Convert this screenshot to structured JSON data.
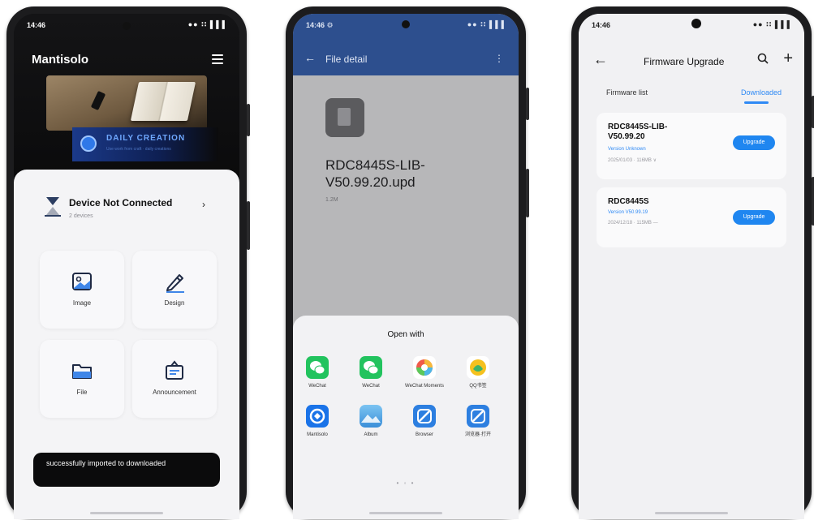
{
  "phone1": {
    "status": {
      "time": "14:46",
      "icons": "●● ∶∶ ▌▌▌"
    },
    "app_title": "Mantisolo",
    "brand": {
      "name": "DAILY CREATION",
      "tagline": "Use work from craft · daily creations"
    },
    "device": {
      "title": "Device Not Connected",
      "subtitle": "2 devices",
      "more": "›"
    },
    "tiles": [
      {
        "label": "Image",
        "icon": "image-icon"
      },
      {
        "label": "Design",
        "icon": "pen-icon"
      },
      {
        "label": "File",
        "icon": "folder-icon"
      },
      {
        "label": "Announcement",
        "icon": "announcement-icon"
      }
    ],
    "toast": "successfully imported to downloaded"
  },
  "phone2": {
    "status": {
      "time": "14:46 ⚙",
      "icons": "●● ∶∶ ▌▌▌"
    },
    "title": "File detail",
    "file_name": "RDC8445S-LIB-V50.99.20.upd",
    "file_size": "1.2M",
    "share_title": "Open with",
    "apps": [
      {
        "label": "WeChat",
        "color": "#22c35e"
      },
      {
        "label": "WeChat",
        "color": "#22c35e"
      },
      {
        "label": "WeChat Moments",
        "color": "#ffffff"
      },
      {
        "label": "QQ书签",
        "color": "#ffffff"
      },
      {
        "label": "Mantisolo",
        "color": "#1a73e8"
      },
      {
        "label": "Album",
        "color": "#4aa3e8"
      },
      {
        "label": "Browser",
        "color": "#2d7fe0"
      },
      {
        "label": "浏览器·打开",
        "color": "#2d7fe0"
      }
    ],
    "dots": "• ◦ •"
  },
  "phone3": {
    "status": {
      "time": "14:46",
      "icons": "●● ∶∶ ▌▌▌"
    },
    "title": "Firmware Upgrade",
    "tabs": [
      {
        "label": "Firmware list",
        "active": false
      },
      {
        "label": "Downloaded",
        "active": true
      }
    ],
    "firmwares": [
      {
        "name": "RDC8445S-LIB-V50.99.20",
        "version": "Version Unknown",
        "date": "2025/01/03 · 116MB ∨",
        "button": "Upgrade"
      },
      {
        "name": "RDC8445S",
        "version": "Version V50.99.19",
        "date": "2024/12/18 · 115MB —",
        "button": "Upgrade"
      }
    ],
    "colors": {
      "accent": "#1f86f0"
    }
  }
}
